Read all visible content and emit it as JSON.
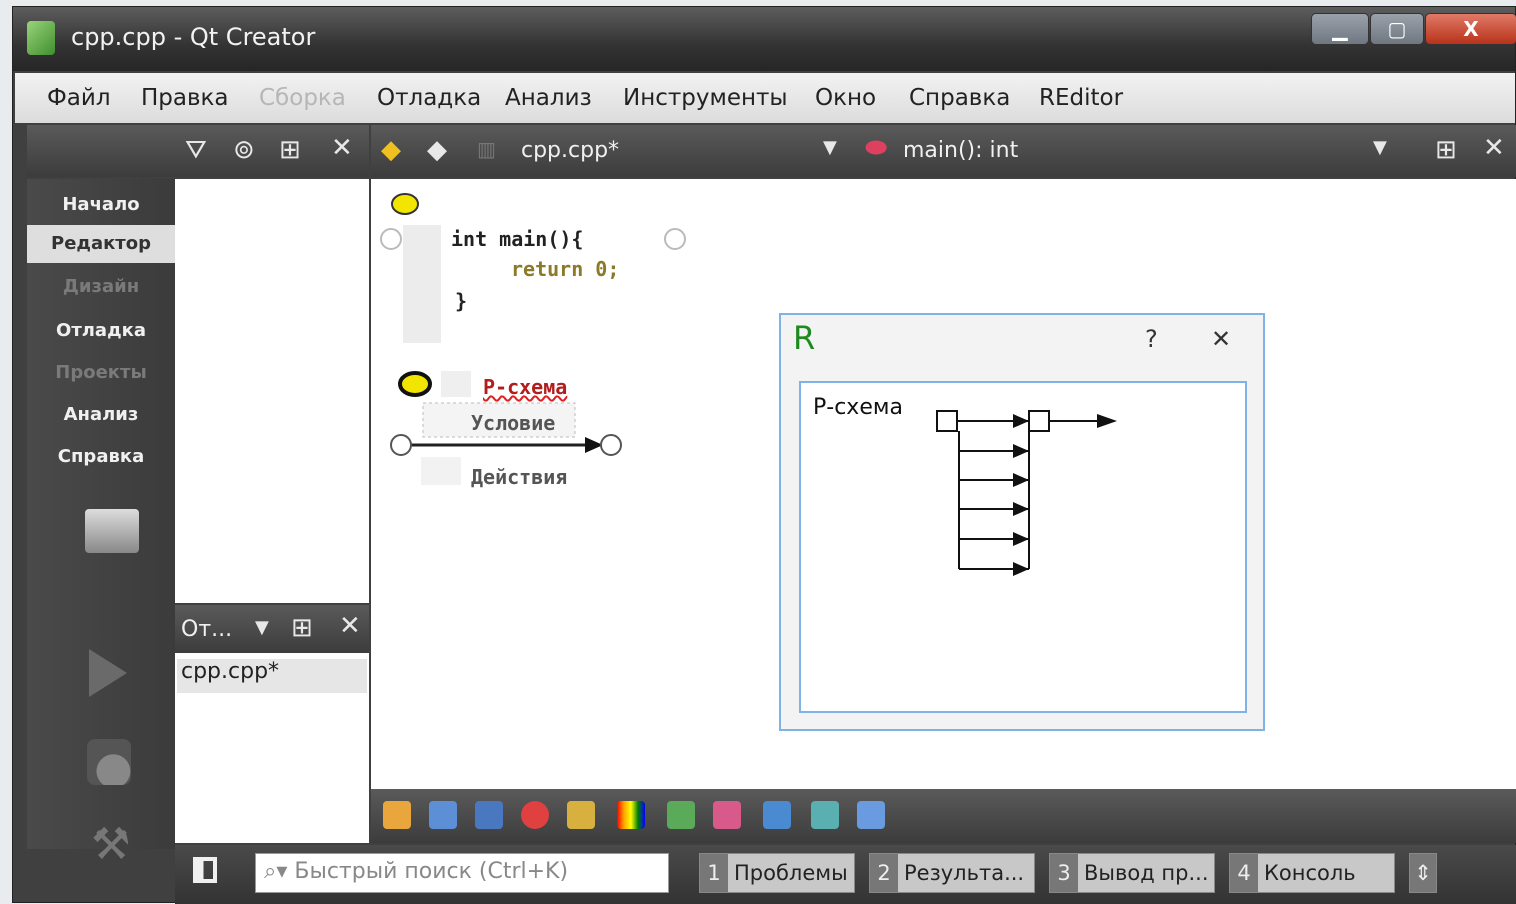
{
  "window": {
    "title": "cpp.cpp - Qt Creator",
    "close_glyph": "X"
  },
  "menu": [
    "Файл",
    "Правка",
    "Сборка",
    "Отладка",
    "Анализ",
    "Инструменты",
    "Окно",
    "Справка",
    "REditor"
  ],
  "editor_toolbar": {
    "file": "cpp.cpp*",
    "function": "main(): int"
  },
  "modes": [
    "Начало",
    "Редактор",
    "Дизайн",
    "Отладка",
    "Проекты",
    "Анализ",
    "Справка"
  ],
  "open_docs": {
    "header": "От...",
    "file": "cpp.cpp*"
  },
  "code": {
    "line1": "int main(){",
    "line2": "return 0;",
    "line3": "}"
  },
  "rscheme_editor": {
    "title": "Р-схема",
    "condition": "Условие",
    "action": "Действия"
  },
  "rdialog": {
    "title": "R",
    "help": "?",
    "close": "✕",
    "label": "Р-схема"
  },
  "status": {
    "search_placeholder": "Быстрый поиск (Ctrl+K)",
    "tabs": [
      {
        "num": "1",
        "label": "Проблемы"
      },
      {
        "num": "2",
        "label": "Результа..."
      },
      {
        "num": "3",
        "label": "Вывод пр..."
      },
      {
        "num": "4",
        "label": "Консоль"
      }
    ]
  }
}
